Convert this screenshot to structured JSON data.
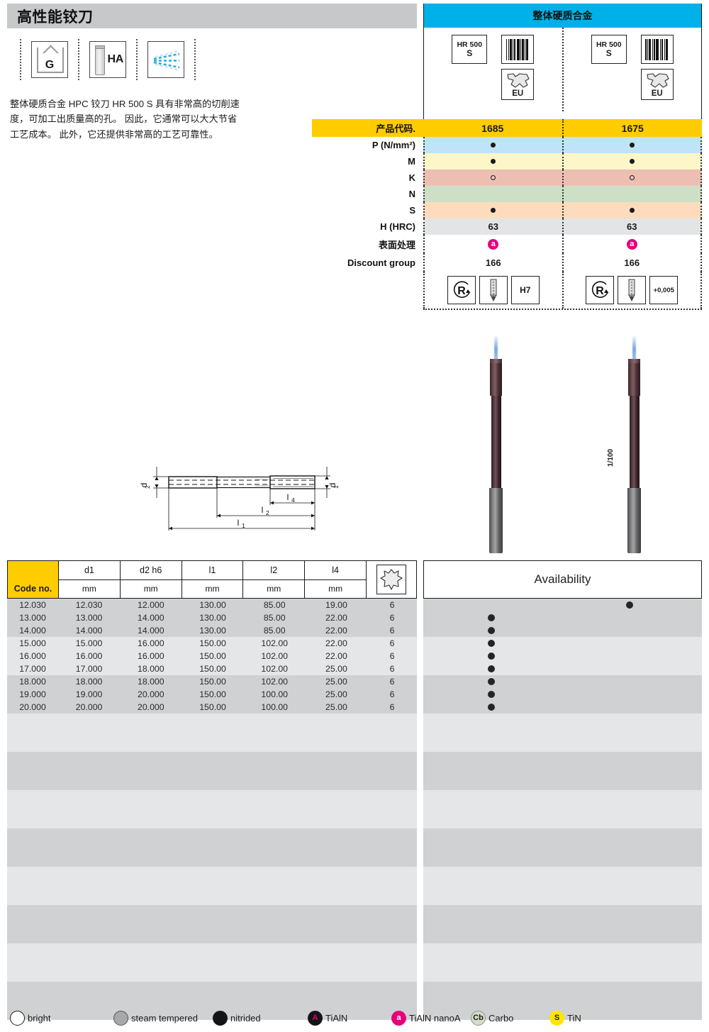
{
  "header": {
    "title": "高性能铰刀",
    "icons": [
      {
        "name": "g-house-icon",
        "label": "G"
      },
      {
        "name": "ha-cylinder-icon",
        "label": "HA"
      },
      {
        "name": "coolant-spray-icon",
        "label": ""
      }
    ],
    "description": "整体硬质合金 HPC 铰刀 HR 500 S 具有非常高的切削速度，可加工出质量高的孔。 因此，它通常可以大大节省工艺成本。 此外，它还提供非常高的工艺可靠性。"
  },
  "product_header": {
    "title": "整体硬质合金",
    "columns": [
      {
        "grade_line1": "HR 500",
        "grade_line2": "S",
        "origin": "EU",
        "code": "1685"
      },
      {
        "grade_line1": "HR 500",
        "grade_line2": "S",
        "origin": "EU",
        "code": "1675"
      }
    ]
  },
  "spec": {
    "rows": [
      {
        "label": "产品代码.",
        "type": "code",
        "values": [
          "1685",
          "1675"
        ],
        "bg": "#ffcc00"
      },
      {
        "label": "P (N/mm²)",
        "type": "mark",
        "values": [
          "filled",
          "filled"
        ],
        "bg": "#bfe3f7"
      },
      {
        "label": "M",
        "type": "mark",
        "values": [
          "filled",
          "filled"
        ],
        "bg": "#fdf6c8"
      },
      {
        "label": "K",
        "type": "mark",
        "values": [
          "open",
          "open"
        ],
        "bg": "#edbfb3"
      },
      {
        "label": "N",
        "type": "mark",
        "values": [
          "",
          ""
        ],
        "bg": "#cde0c5"
      },
      {
        "label": "S",
        "type": "mark",
        "values": [
          "filled",
          "filled"
        ],
        "bg": "#fcdcbd"
      },
      {
        "label": "H (HRC)",
        "type": "text",
        "values": [
          "63",
          "63"
        ],
        "bg": "#e3e4e6"
      },
      {
        "label": "表面处理",
        "type": "badge",
        "values": [
          "a",
          "a"
        ],
        "bg": "#ffffff"
      },
      {
        "label": "Discount group",
        "type": "text",
        "values": [
          "166",
          "166"
        ],
        "bg": "#ffffff"
      }
    ],
    "icon_row": {
      "col1": [
        "R",
        "point-down",
        "H7"
      ],
      "col2": [
        "R",
        "point-down",
        "+0,005"
      ]
    }
  },
  "photos": {
    "tool1_note": "",
    "tool2_note": "1/100"
  },
  "drawing": {
    "labels": [
      "d₂",
      "d₁",
      "l₄",
      "l₂",
      "l₁"
    ]
  },
  "data_table": {
    "code_header": "Code no.",
    "columns": [
      {
        "name": "d1",
        "unit": "mm"
      },
      {
        "name": "d2 h6",
        "unit": "mm"
      },
      {
        "name": "l1",
        "unit": "mm"
      },
      {
        "name": "l2",
        "unit": "mm"
      },
      {
        "name": "l4",
        "unit": "mm"
      }
    ],
    "flute_header_icon": "flute-cross-section-icon",
    "rows": [
      {
        "code": "12.030",
        "d1": "12.030",
        "d2": "12.000",
        "l1": "130.00",
        "l2": "85.00",
        "l4": "19.00",
        "z": "6",
        "avail": [
          false,
          true
        ]
      },
      {
        "code": "13.000",
        "d1": "13.000",
        "d2": "14.000",
        "l1": "130.00",
        "l2": "85.00",
        "l4": "22.00",
        "z": "6",
        "avail": [
          true,
          false
        ]
      },
      {
        "code": "14.000",
        "d1": "14.000",
        "d2": "14.000",
        "l1": "130.00",
        "l2": "85.00",
        "l4": "22.00",
        "z": "6",
        "avail": [
          true,
          false
        ]
      },
      {
        "code": "15.000",
        "d1": "15.000",
        "d2": "16.000",
        "l1": "150.00",
        "l2": "102.00",
        "l4": "22.00",
        "z": "6",
        "avail": [
          true,
          false
        ]
      },
      {
        "code": "16.000",
        "d1": "16.000",
        "d2": "16.000",
        "l1": "150.00",
        "l2": "102.00",
        "l4": "22.00",
        "z": "6",
        "avail": [
          true,
          false
        ]
      },
      {
        "code": "17.000",
        "d1": "17.000",
        "d2": "18.000",
        "l1": "150.00",
        "l2": "102.00",
        "l4": "25.00",
        "z": "6",
        "avail": [
          true,
          false
        ]
      },
      {
        "code": "18.000",
        "d1": "18.000",
        "d2": "18.000",
        "l1": "150.00",
        "l2": "102.00",
        "l4": "25.00",
        "z": "6",
        "avail": [
          true,
          false
        ]
      },
      {
        "code": "19.000",
        "d1": "19.000",
        "d2": "20.000",
        "l1": "150.00",
        "l2": "100.00",
        "l4": "25.00",
        "z": "6",
        "avail": [
          true,
          false
        ]
      },
      {
        "code": "20.000",
        "d1": "20.000",
        "d2": "20.000",
        "l1": "150.00",
        "l2": "100.00",
        "l4": "25.00",
        "z": "6",
        "avail": [
          true,
          false
        ]
      }
    ],
    "empty_row_count": 24
  },
  "availability": {
    "title": "Availability"
  },
  "legend": [
    {
      "name": "bright",
      "label": "bright",
      "symbol": "",
      "style": "bright"
    },
    {
      "name": "steam-tempered",
      "label": "steam tempered",
      "symbol": "",
      "style": "steam"
    },
    {
      "name": "nitrided",
      "label": "nitrided",
      "symbol": "",
      "style": "nitrided"
    },
    {
      "name": "tialn",
      "label": "TiAlN",
      "symbol": "A",
      "style": "tialn"
    },
    {
      "name": "tialn-nanoa",
      "label": "TiAlN nanoA",
      "symbol": "a",
      "style": "nano"
    },
    {
      "name": "carbo",
      "label": "Carbo",
      "symbol": "Cb",
      "style": "carbo"
    },
    {
      "name": "tin",
      "label": "TiN",
      "symbol": "S",
      "style": "tin"
    }
  ]
}
